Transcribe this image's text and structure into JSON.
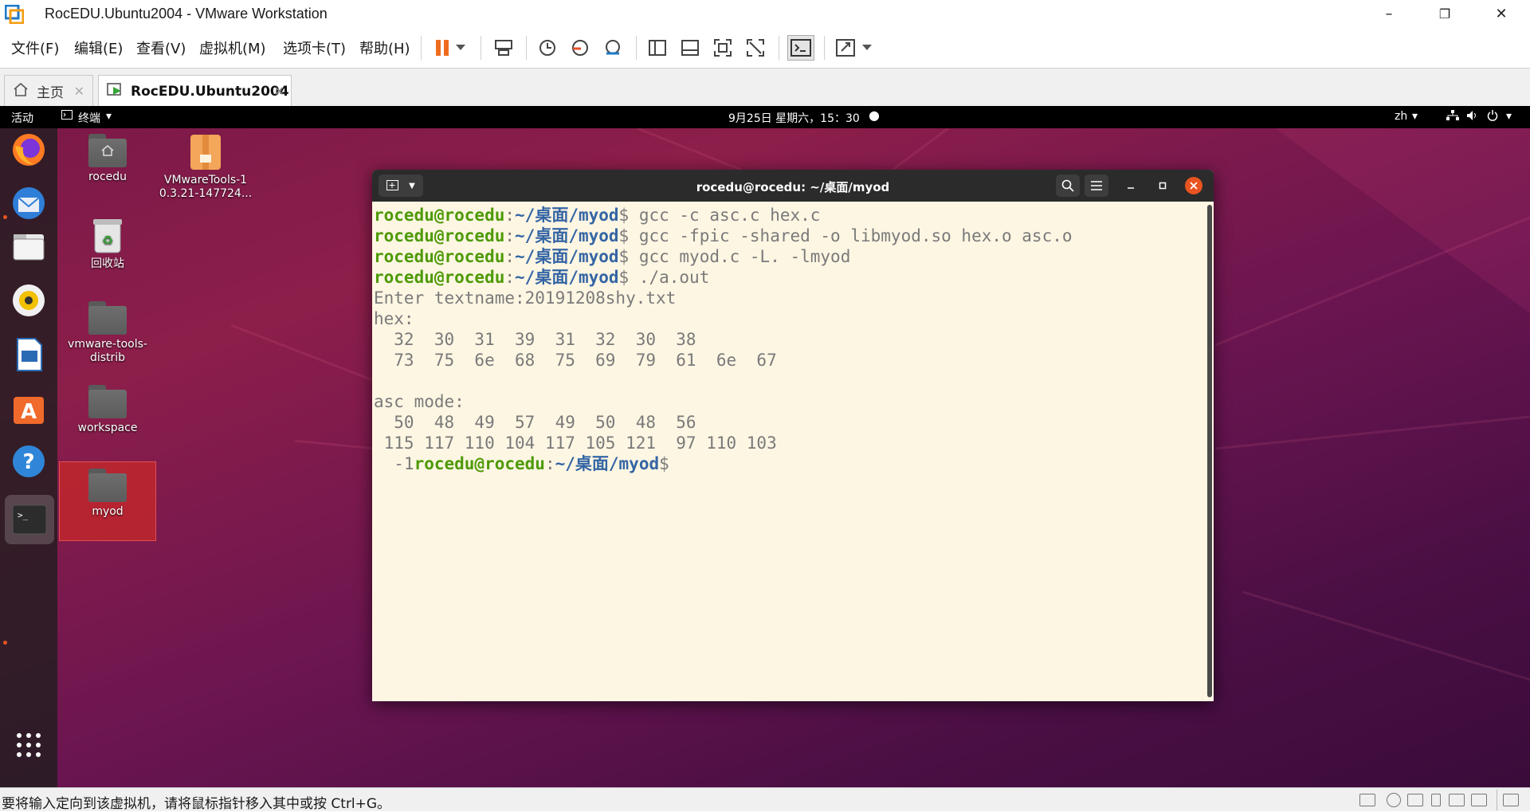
{
  "window": {
    "title": "RocEDU.Ubuntu2004 - VMware Workstation",
    "controls": {
      "minimize": "–",
      "maximize": "❐",
      "close": "✕"
    }
  },
  "menu": {
    "items": [
      "文件(F)",
      "编辑(E)",
      "查看(V)",
      "虚拟机(M)",
      "选项卡(T)",
      "帮助(H)"
    ]
  },
  "tabs": [
    {
      "label": "主页",
      "icon": "home-icon",
      "active": false
    },
    {
      "label": "RocEDU.Ubuntu2004",
      "icon": "vm-play-icon",
      "active": true
    }
  ],
  "gnome": {
    "activities": "活动",
    "app_menu": "终端",
    "clock": "9月25日 星期六，15：30",
    "lang": "zh"
  },
  "desktop": {
    "icons": [
      {
        "label": "rocedu",
        "icon": "home-folder-icon"
      },
      {
        "label": "VMwareTools-10.3.21-147724...",
        "label_line1": "VMwareTools-1",
        "label_line2": "0.3.21-147724...",
        "icon": "archive-icon"
      },
      {
        "label": "回收站",
        "icon": "trash-icon"
      },
      {
        "label_line1": "vmware-tools-",
        "label_line2": "distrib",
        "icon": "folder-icon"
      },
      {
        "label": "workspace",
        "icon": "folder-icon"
      },
      {
        "label": "myod",
        "icon": "folder-icon",
        "selected": true
      }
    ]
  },
  "terminal": {
    "title": "rocedu@rocedu: ~/桌面/myod",
    "prompt_user": "rocedu@rocedu",
    "prompt_path": "~/桌面/myod",
    "lines": [
      {
        "type": "cmd",
        "text": "gcc -c asc.c hex.c"
      },
      {
        "type": "cmd",
        "text": "gcc -fpic -shared -o libmyod.so hex.o asc.o"
      },
      {
        "type": "cmd",
        "text": "gcc myod.c -L. -lmyod"
      },
      {
        "type": "cmd",
        "text": "./a.out"
      },
      {
        "type": "out",
        "text": "Enter textname:20191208shy.txt"
      },
      {
        "type": "out",
        "text": "hex:"
      },
      {
        "type": "out",
        "text": "  32  30  31  39  31  32  30  38"
      },
      {
        "type": "out",
        "text": "  73  75  6e  68  75  69  79  61  6e  67"
      },
      {
        "type": "out",
        "text": ""
      },
      {
        "type": "out",
        "text": "asc mode:"
      },
      {
        "type": "out",
        "text": "  50  48  49  57  49  50  48  56"
      },
      {
        "type": "out",
        "text": " 115 117 110 104 117 105 121  97 110 103"
      },
      {
        "type": "tail",
        "prefix": "  -1",
        "text": ""
      }
    ]
  },
  "status": {
    "text": "要将输入定向到该虚拟机，请将鼠标指针移入其中或按 Ctrl+G。"
  }
}
